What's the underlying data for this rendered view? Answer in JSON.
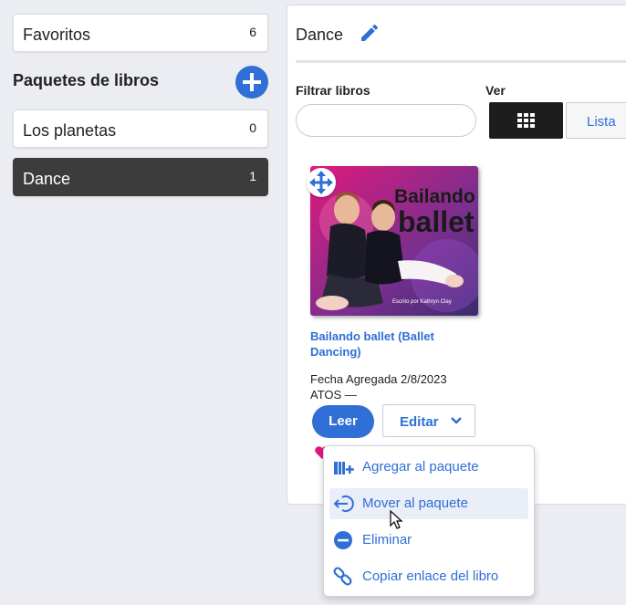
{
  "sidebar": {
    "favorites": {
      "label": "Favoritos",
      "count": "6"
    },
    "heading": "Paquetes de libros",
    "packages": [
      {
        "label": "Los planetas",
        "count": "0"
      },
      {
        "label": "Dance",
        "count": "1"
      }
    ]
  },
  "panel": {
    "title": "Dance",
    "filter_label": "Filtrar libros",
    "filter_value": "",
    "view_label": "Ver",
    "list_label": "Lista"
  },
  "book": {
    "cover_title_line1": "Bailando",
    "cover_title_line2": "ballet",
    "cover_author": "Escrito por Kathryn Clay",
    "title": "Bailando ballet (Ballet Dancing)",
    "date_added": "Fecha Agregada 2/8/2023",
    "atos": "ATOS —",
    "read_label": "Leer",
    "edit_label": "Editar"
  },
  "menu": {
    "items": [
      {
        "label": "Agregar al paquete",
        "icon": "add-to-package-icon"
      },
      {
        "label": "Mover al paquete",
        "icon": "move-to-package-icon"
      },
      {
        "label": "Eliminar",
        "icon": "remove-icon"
      },
      {
        "label": "Copiar enlace del libro",
        "icon": "link-icon"
      }
    ]
  },
  "colors": {
    "accent": "#2f6fd6",
    "active": "#3c3c3c"
  }
}
